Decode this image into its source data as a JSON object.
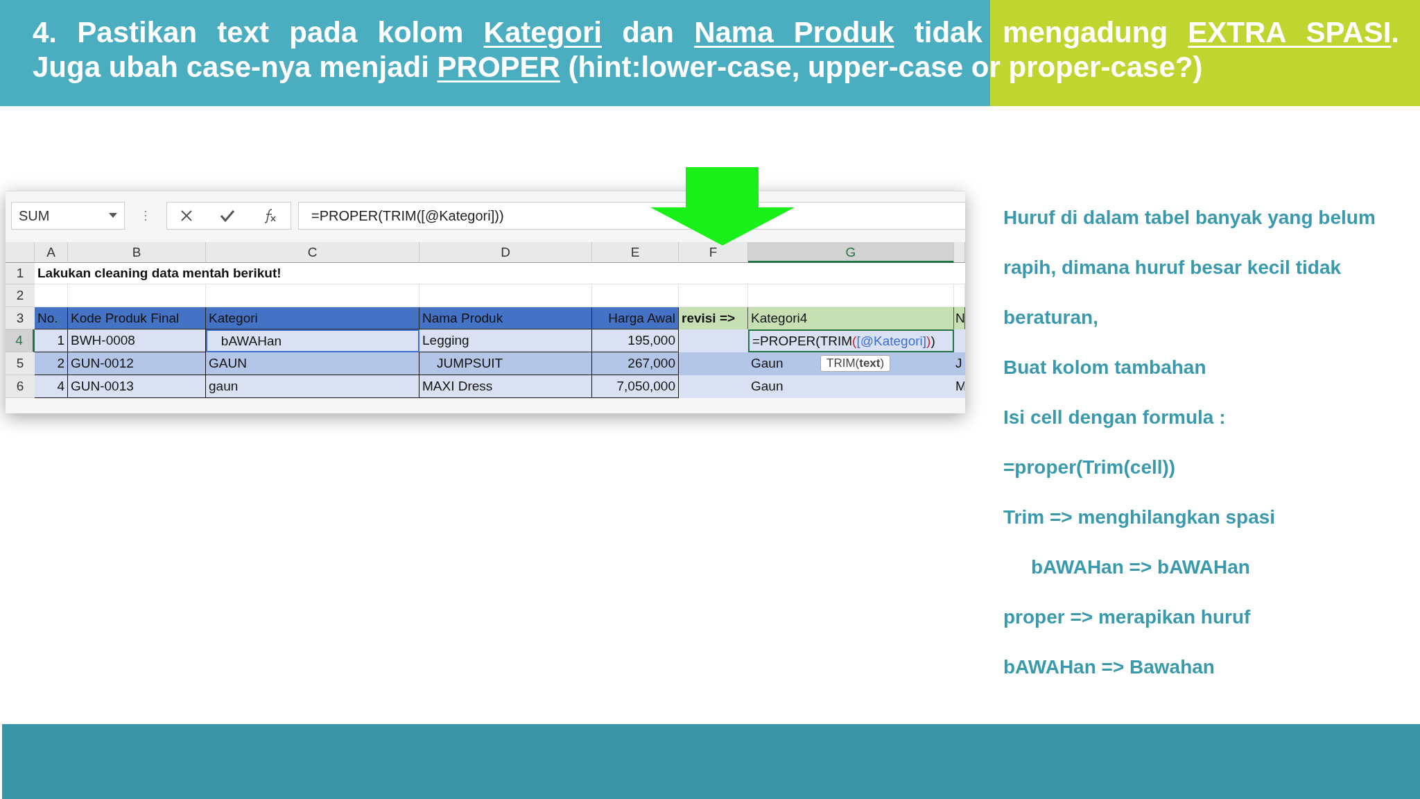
{
  "slide_title": {
    "lines": [
      [
        {
          "text": "4. Pastikan text pada kolom ",
          "underline": false
        },
        {
          "text": "Kategori",
          "underline": true
        },
        {
          "text": " dan ",
          "underline": false
        },
        {
          "text": "Nama Produk",
          "underline": true
        },
        {
          "text": " tidak mengadung ",
          "underline": false
        },
        {
          "text": "EXTRA SPASI",
          "underline": true
        },
        {
          "text": ".",
          "underline": false
        }
      ],
      [
        {
          "text": "Juga ubah case-nya menjadi ",
          "underline": false
        },
        {
          "text": "PROPER",
          "underline": true
        },
        {
          "text": " (hint:lower-case, upper-case or proper-case?)",
          "underline": false
        }
      ]
    ]
  },
  "excel": {
    "name_box": "SUM",
    "formula": "=PROPER(TRIM([@Kategori]))",
    "columns": [
      {
        "letter": "A",
        "selected": false
      },
      {
        "letter": "B",
        "selected": false
      },
      {
        "letter": "C",
        "selected": false
      },
      {
        "letter": "D",
        "selected": false
      },
      {
        "letter": "E",
        "selected": false
      },
      {
        "letter": "F",
        "selected": false
      },
      {
        "letter": "G",
        "selected": true
      }
    ],
    "rows": [
      {
        "number": "1",
        "selected": false,
        "kind": "title",
        "cells": [
          {
            "text": "Lakukan cleaning data mentah berikut!"
          }
        ]
      },
      {
        "number": "2",
        "selected": false,
        "kind": "blank",
        "cells": []
      },
      {
        "number": "3",
        "selected": false,
        "kind": "header",
        "cells": [
          {
            "text": "No."
          },
          {
            "text": "Kode Produk Final"
          },
          {
            "text": "Kategori"
          },
          {
            "text": "Nama Produk"
          },
          {
            "text": "Harga Awal"
          },
          {
            "text": "revisi =>",
            "bold": true
          },
          {
            "text": "Kategori4"
          },
          {
            "text": "N"
          }
        ]
      },
      {
        "number": "4",
        "selected": true,
        "kind": "data",
        "cells": [
          {
            "text": "1"
          },
          {
            "text": "BWH-0008"
          },
          {
            "text": "   bAWAHan",
            "referenced": true
          },
          {
            "text": "Legging"
          },
          {
            "text": "195,000"
          },
          {},
          {
            "editing": true,
            "segments": [
              {
                "text": "=PROPER(TRIM",
                "kind": "plain"
              },
              {
                "text": "(",
                "kind": "paren"
              },
              {
                "text": "[@Kategori]",
                "kind": "ref"
              },
              {
                "text": ")",
                "kind": "paren"
              },
              {
                "text": ")",
                "kind": "plain"
              }
            ]
          },
          {}
        ]
      },
      {
        "number": "5",
        "selected": false,
        "kind": "data",
        "cells": [
          {
            "text": "2"
          },
          {
            "text": "GUN-0012"
          },
          {
            "text": "GAUN"
          },
          {
            "text": "    JUMPSUIT"
          },
          {
            "text": "267,000"
          },
          {},
          {
            "text": "Gaun",
            "tooltip": "TRIM(**text**)"
          },
          {
            "text": "J"
          }
        ]
      },
      {
        "number": "6",
        "selected": false,
        "kind": "data",
        "cells": [
          {
            "text": "4"
          },
          {
            "text": "GUN-0013"
          },
          {
            "text": "gaun"
          },
          {
            "text": "MAXI Dress"
          },
          {
            "text": "7,050,000"
          },
          {},
          {
            "text": "Gaun"
          },
          {
            "text": "M"
          }
        ]
      }
    ]
  },
  "notes": [
    {
      "text": "Huruf di dalam tabel banyak yang belum",
      "indented": false
    },
    {
      "text": "rapih, dimana huruf besar kecil tidak",
      "indented": false
    },
    {
      "text": "beraturan,",
      "indented": false
    },
    {
      "text": "Buat kolom tambahan",
      "indented": false
    },
    {
      "text": "Isi cell dengan formula :",
      "indented": false
    },
    {
      "text": "=proper(Trim(cell))",
      "indented": false
    },
    {
      "text": "Trim => menghilangkan spasi",
      "indented": false
    },
    {
      "text": "bAWAHan => bAWAHan",
      "indented": true
    },
    {
      "text": "proper => merapikan huruf",
      "indented": false
    },
    {
      "text": "bAWAHan => Bawahan",
      "indented": false
    }
  ]
}
